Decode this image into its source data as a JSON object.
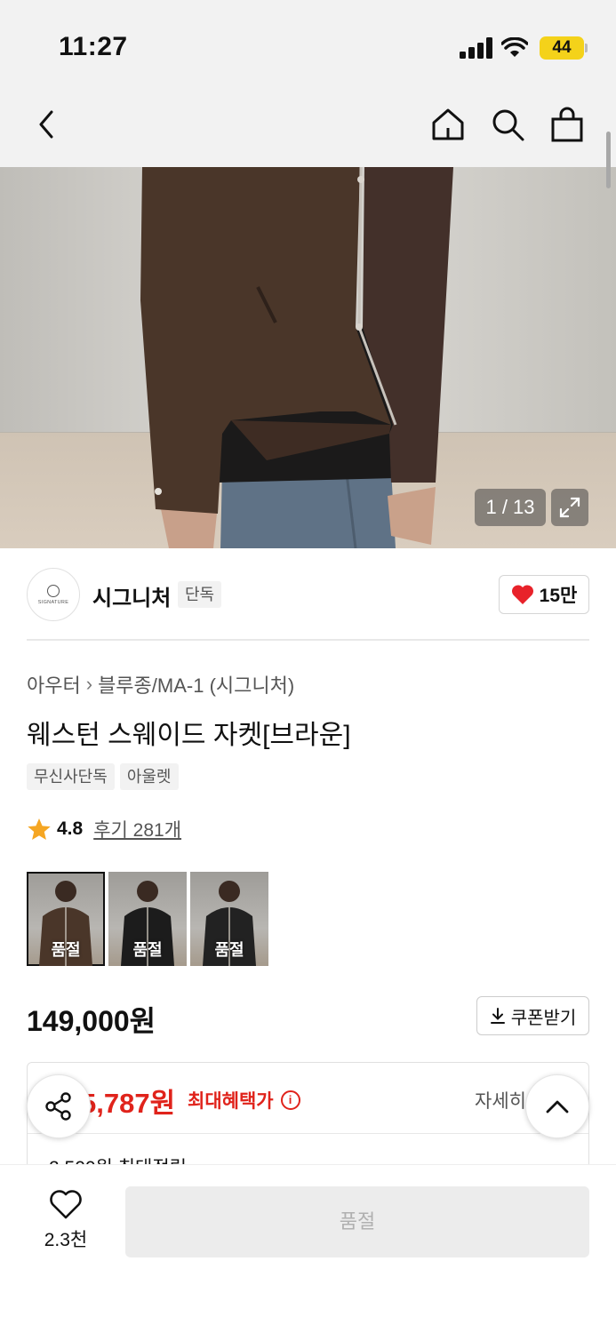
{
  "status_bar": {
    "time": "11:27",
    "battery": "44",
    "icons": [
      "signal-icon",
      "wifi-icon",
      "battery-icon"
    ]
  },
  "nav": {
    "icons": [
      "back-icon",
      "home-icon",
      "search-icon",
      "shopping-bag-icon"
    ]
  },
  "gallery": {
    "counter": "1 / 13"
  },
  "brand": {
    "name": "시그니처",
    "logo_text": "SIGNATURE",
    "badge": "단독",
    "likes": "15만"
  },
  "product": {
    "breadcrumb": [
      "아우터",
      "블루종/MA-1 (시그니처)"
    ],
    "title": "웨스턴 스웨이드 자켓[브라운]",
    "tags": [
      "무신사단독",
      "아울렛"
    ],
    "rating": "4.8",
    "reviews": "후기 281개",
    "color_options": [
      {
        "label": "품절",
        "tone": "#4a3629"
      },
      {
        "label": "품절",
        "tone": "#1c1c1c"
      },
      {
        "label": "품절",
        "tone": "#222222"
      }
    ],
    "price": "149,000원",
    "coupon_label": "쿠폰받기"
  },
  "benefit": {
    "max_price": "5,787원",
    "max_label": "최대혜택가",
    "detail": "자세히",
    "points": "2,500원 최대적립"
  },
  "bottom": {
    "wish_count": "2.3천",
    "action_label": "품절"
  },
  "colors": {
    "accent_red": "#e0231b",
    "heart_red": "#e8222a",
    "star": "#f5a623",
    "battery": "#f4d21a"
  }
}
